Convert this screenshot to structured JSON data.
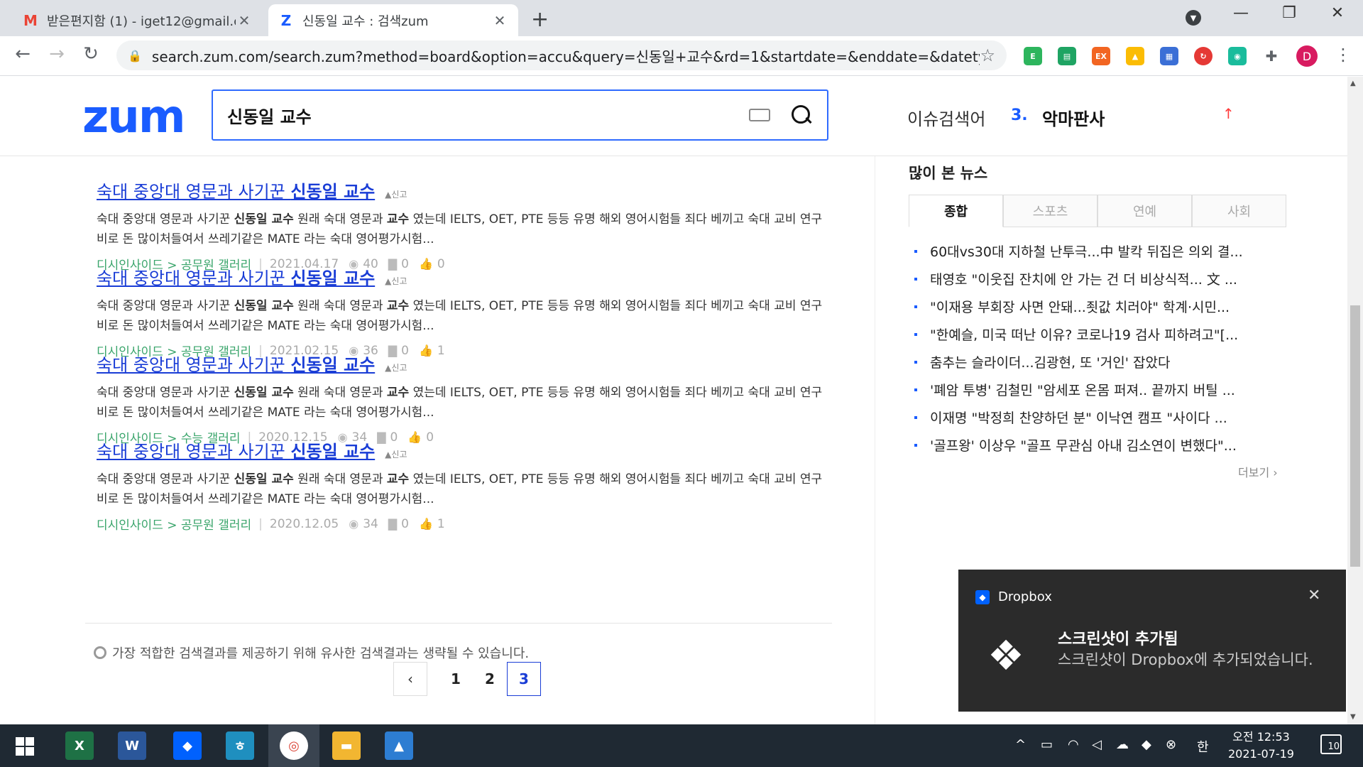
{
  "browser": {
    "tabs": [
      {
        "title": "받은편지함 (1) - iget12@gmail.c",
        "favicon": "gmail-icon",
        "color": "#ea4335"
      },
      {
        "title": "신동일 교수 : 검색zum",
        "favicon": "zum-icon",
        "color": "#1a5cff"
      }
    ],
    "url": "search.zum.com/search.zum?method=board&option=accu&query=신동일+교수&rd=1&startdate=&enddate=&datety...",
    "profile_initial": "D"
  },
  "site": {
    "logo": "zum",
    "search_query": "신동일 교수",
    "issue_label": "이슈검색어",
    "issue_rank": "3.",
    "issue_word": "악마판사",
    "issue_trend": "↑"
  },
  "results": [
    {
      "title_pre": "숙대 중앙대 영문과 사기꾼 ",
      "title_bold": "신동일 교수",
      "report": "신고",
      "snippet_a": "숙대 중앙대 영문과 사기꾼 ",
      "snippet_b1": "신동일 교수",
      "snippet_c": " 원래 숙대 영문과 ",
      "snippet_b2": "교수",
      "snippet_d": " 였는데 IELTS, OET, PTE 등등 유명 해외 영어시험들 죄다 베끼고 숙대 교비 연구비로 돈 많이처들여서 쓰레기같은 MATE 라는 숙대 영어평가시험...",
      "source": "디시인사이드 > 공무원 갤러리",
      "date": "2021.04.17",
      "views": "40",
      "comments": "0",
      "likes": "0"
    },
    {
      "title_pre": "숙대 중앙대 영문과 사기꾼 ",
      "title_bold": "신동일 교수",
      "report": "신고",
      "snippet_a": "숙대 중앙대 영문과 사기꾼 ",
      "snippet_b1": "신동일 교수",
      "snippet_c": " 원래 숙대 영문과 ",
      "snippet_b2": "교수",
      "snippet_d": " 였는데 IELTS, OET, PTE 등등 유명 해외 영어시험들 죄다 베끼고 숙대 교비 연구비로 돈 많이처들여서 쓰레기같은 MATE 라는 숙대 영어평가시험...",
      "source": "디시인사이드 > 공무원 갤러리",
      "date": "2021.02.15",
      "views": "36",
      "comments": "0",
      "likes": "1"
    },
    {
      "title_pre": "숙대 중앙대 영문과 사기꾼 ",
      "title_bold": "신동일 교수",
      "report": "신고",
      "snippet_a": "숙대 중앙대 영문과 사기꾼 ",
      "snippet_b1": "신동일 교수",
      "snippet_c": " 원래 숙대 영문과 ",
      "snippet_b2": "교수",
      "snippet_d": " 였는데 IELTS, OET, PTE 등등 유명 해외 영어시험들 죄다 베끼고 숙대 교비 연구비로 돈 많이처들여서 쓰레기같은 MATE 라는 숙대 영어평가시험...",
      "source": "디시인사이드 > 수능 갤러리",
      "date": "2020.12.15",
      "views": "34",
      "comments": "0",
      "likes": "0"
    },
    {
      "title_pre": "숙대 중앙대 영문과 사기꾼 ",
      "title_bold": "신동일 교수",
      "report": "신고",
      "snippet_a": "숙대 중앙대 영문과 사기꾼 ",
      "snippet_b1": "신동일 교수",
      "snippet_c": " 원래 숙대 영문과 ",
      "snippet_b2": "교수",
      "snippet_d": " 였는데 IELTS, OET, PTE 등등 유명 해외 영어시험들 죄다 베끼고 숙대 교비 연구비로 돈 많이처들여서 쓰레기같은 MATE 라는 숙대 영어평가시험...",
      "source": "디시인사이드 > 공무원 갤러리",
      "date": "2020.12.05",
      "views": "34",
      "comments": "0",
      "likes": "1"
    }
  ],
  "notice": "가장 적합한 검색결과를 제공하기 위해 유사한 검색결과는 생략될 수 있습니다.",
  "pagination": {
    "prev": "‹",
    "pages": [
      "1",
      "2",
      "3"
    ],
    "current": "3"
  },
  "news": {
    "title": "많이 본 뉴스",
    "tabs": [
      "종합",
      "스포츠",
      "연예",
      "사회"
    ],
    "active_tab": "종합",
    "items": [
      "60대vs30대 지하철 난투극...中 발칵 뒤집은 의외 결...",
      "태영호 \"이웃집 잔치에 안 가는 건 더 비상식적... 文 ...",
      "\"이재용 부회장 사면 안돼...죗값 치러야\" 학계·시민...",
      "\"한예슬, 미국 떠난 이유? 코로나19 검사 피하려고\"[...",
      "춤추는 슬라이더...김광현, 또 '거인' 잡았다",
      "'폐암 투병' 김철민 \"암세포 온몸 퍼져.. 끝까지 버틸 ...",
      "이재명 \"박정희 찬양하던 분\" 이낙연 캠프 \"사이다 ...",
      "'골프왕' 이상우 \"골프 무관심 아내 김소연이 변했다\"..."
    ],
    "more": "더보기 ›"
  },
  "toast": {
    "app": "Dropbox",
    "heading": "스크린샷이 추가됨",
    "message": "스크린샷이 Dropbox에 추가되었습니다."
  },
  "taskbar": {
    "time": "오전 12:53",
    "date": "2021-07-19",
    "ime": "한",
    "notifications": "10"
  }
}
